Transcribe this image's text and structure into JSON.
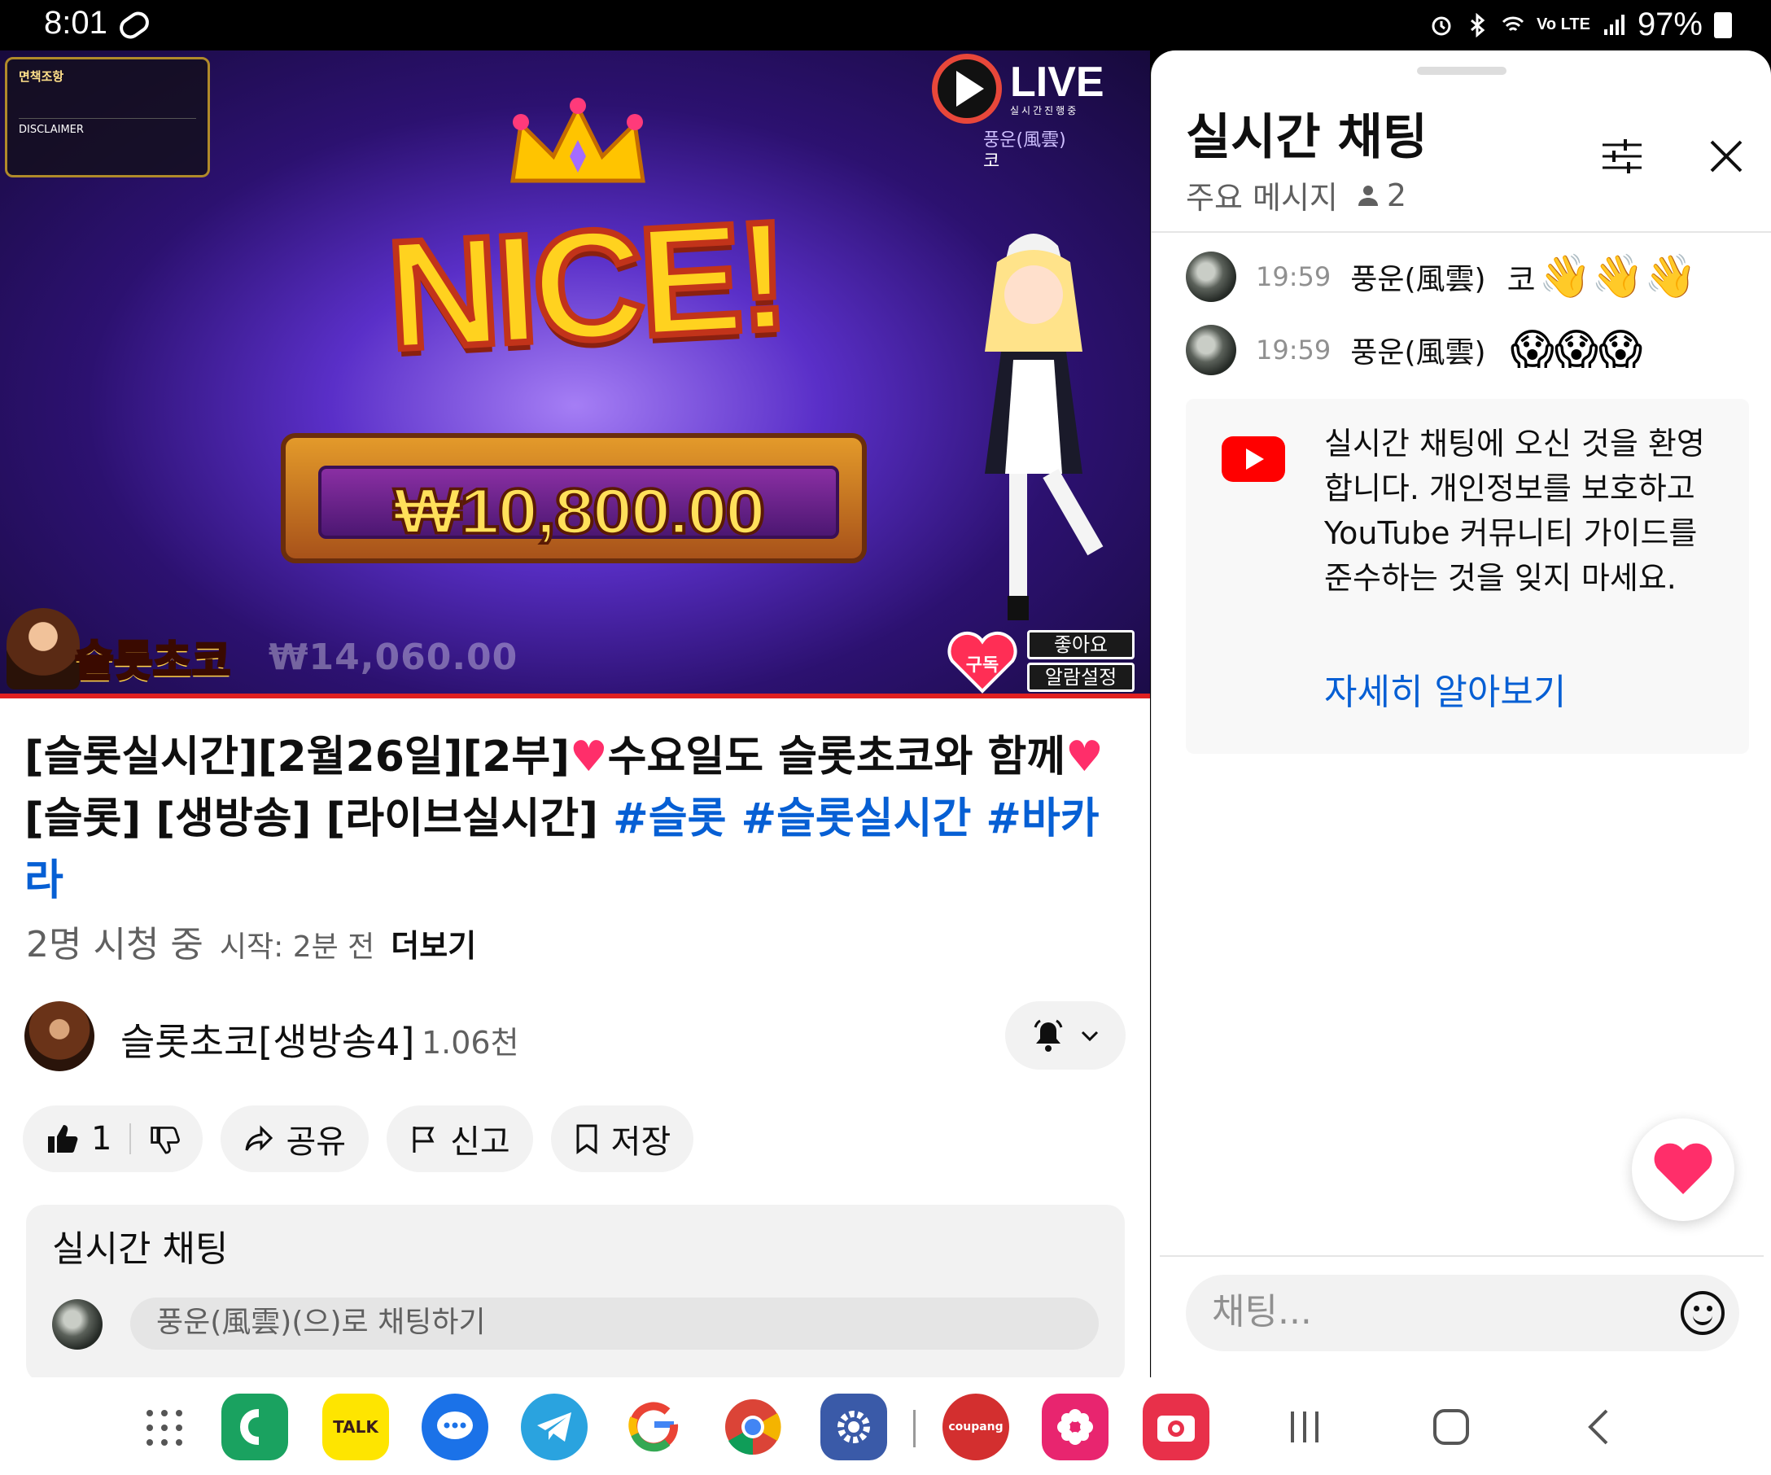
{
  "status_bar": {
    "time": "8:01",
    "network": "Vo LTE",
    "battery": "97%",
    "icons": [
      "alarm-icon",
      "bluetooth-icon",
      "wifi-icon",
      "signal-icon",
      "battery-icon"
    ]
  },
  "video": {
    "disclaimer_title": "면책조항",
    "disclaimer_title_en": "DISCLAIMER",
    "live_logo": "LIVE",
    "live_logo_sub": "실시간진행중",
    "overlay_user": "풍운(風雲)",
    "overlay_msg": "코",
    "win_banner": "NICE!",
    "win_amount": "₩10,800.00",
    "ghost_total": "₩14,060.00",
    "channel_logo": "슬롯초코",
    "subscribe_overlay": "구독",
    "like_overlay": "좋아요",
    "alarm_overlay": "알람설정",
    "progress": 1.0
  },
  "title": {
    "part1": "[슬롯실시간][2월26일][2부]",
    "heart": "♥",
    "part2": "수요일도 슬롯초코와 함께",
    "part3": "[슬롯] [생방송] [라이브실시간] ",
    "tags": "#슬롯 #슬롯실시간 #바카라"
  },
  "meta": {
    "viewers": "2명 시청 중",
    "started": "시작: 2분 전",
    "more": "더보기"
  },
  "channel": {
    "name": "슬롯초코[생방송4]",
    "subscribers": "1.06천"
  },
  "actions": {
    "like_count": "1",
    "share": "공유",
    "report": "신고",
    "save": "저장"
  },
  "chat_card": {
    "title": "실시간 채팅",
    "placeholder": "풍운(風雲)(으)로 채팅하기"
  },
  "chat_panel": {
    "title": "실시간 채팅",
    "filter": "주요 메시지",
    "participants": "2",
    "messages": [
      {
        "time": "19:59",
        "author": "풍운(風雲)",
        "text": "코",
        "emoji": "👋👋👋"
      },
      {
        "time": "19:59",
        "author": "풍운(風雲)",
        "text": "",
        "emoji": "😱😱😱"
      }
    ],
    "welcome": "실시간 채팅에 오신 것을 환영합니다. 개인정보를 보호하고 YouTube 커뮤니티 가이드를 준수하는 것을 잊지 마세요.",
    "learn_more": "자세히 알아보기",
    "input_placeholder": "채팅..."
  },
  "dock": {
    "apps": [
      "app-drawer-icon",
      "phone-icon",
      "kakaotalk-icon",
      "messages-icon",
      "telegram-icon",
      "google-icon",
      "chrome-icon",
      "settings-icon",
      "coupang-icon",
      "flower-app-icon",
      "camera-icon"
    ],
    "kakao_label": "TALK",
    "coupang_label": "coupang"
  },
  "colors": {
    "accent_blue": "#065fd4",
    "youtube_red": "#ff0000",
    "heart_pink": "#ff2e6a"
  }
}
